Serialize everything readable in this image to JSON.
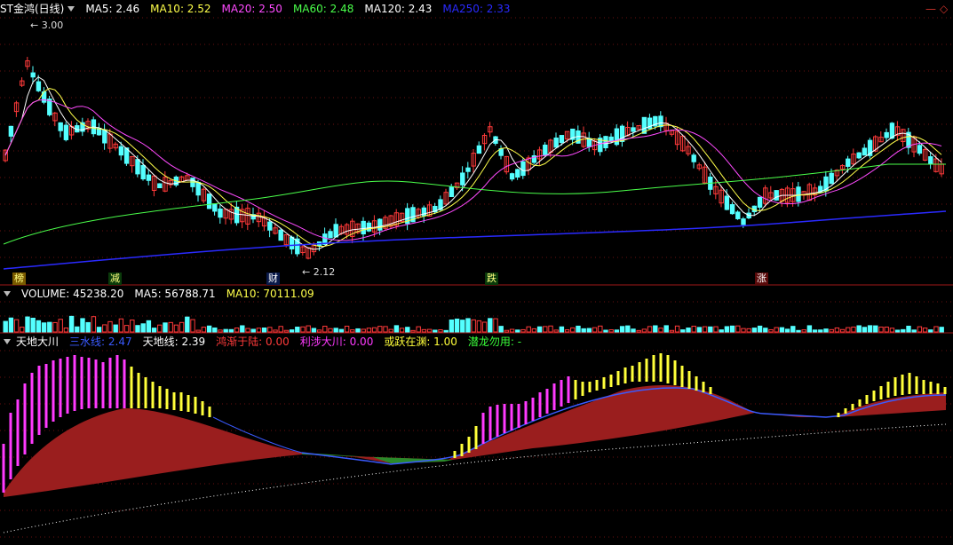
{
  "stock": {
    "name": "ST金鸿",
    "period": "(日线)"
  },
  "main_legend": [
    {
      "label": "MA5:",
      "value": "2.46",
      "color": "#ffffff"
    },
    {
      "label": "MA10:",
      "value": "2.52",
      "color": "#ffff4a"
    },
    {
      "label": "MA20:",
      "value": "2.50",
      "color": "#ff4aff"
    },
    {
      "label": "MA60:",
      "value": "2.48",
      "color": "#4aff4a"
    },
    {
      "label": "MA120:",
      "value": "2.43",
      "color": "#ffffff"
    },
    {
      "label": "MA250:",
      "value": "2.33",
      "color": "#2a2aff"
    }
  ],
  "price_annotations": {
    "high": "3.00",
    "low": "2.12"
  },
  "markers": [
    {
      "text": "榜",
      "bg": "#7a5a00",
      "color": "#ffff80"
    },
    {
      "text": "减",
      "bg": "#0a3a0a",
      "color": "#ffff80"
    },
    {
      "text": "财",
      "bg": "#0a1a4a",
      "color": "#ffffff"
    },
    {
      "text": "跌",
      "bg": "#0a3a0a",
      "color": "#ffff80"
    },
    {
      "text": "涨",
      "bg": "#5a0a0a",
      "color": "#ffffff"
    }
  ],
  "volume_legend": [
    {
      "label": "VOLUME:",
      "value": "45238.20",
      "color": "#ffffff"
    },
    {
      "label": "MA5:",
      "value": "56788.71",
      "color": "#ffffff"
    },
    {
      "label": "MA10:",
      "value": "70111.09",
      "color": "#ffff4a"
    }
  ],
  "indicator": {
    "name": "天地大川",
    "legend": [
      {
        "label": "三水线:",
        "value": "2.47",
        "color": "#3a5aff"
      },
      {
        "label": "天地线:",
        "value": "2.39",
        "color": "#ffffff"
      },
      {
        "label": "鸿渐于陆:",
        "value": "0.00",
        "color": "#ff3a3a"
      },
      {
        "label": "利涉大川:",
        "value": "0.00",
        "color": "#ff3aff"
      },
      {
        "label": "或跃在渊:",
        "value": "1.00",
        "color": "#ffff3a"
      },
      {
        "label": "潜龙勿用:",
        "value": "-",
        "color": "#3aff3a"
      }
    ]
  },
  "colors": {
    "up": "#ff3a3a",
    "down": "#54ffff",
    "grid": "#a01818",
    "bg": "#000000"
  }
}
